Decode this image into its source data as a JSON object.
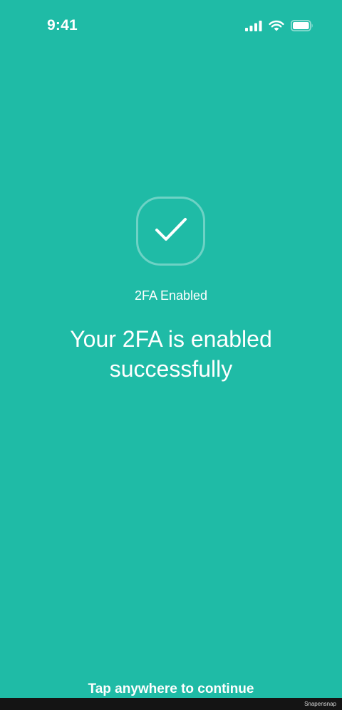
{
  "status_bar": {
    "time": "9:41",
    "icons": [
      "cellular-signal-icon",
      "wifi-icon",
      "battery-icon"
    ]
  },
  "success": {
    "icon": "checkmark-icon",
    "label": "2FA Enabled",
    "headline": "Your 2FA is enabled successfully"
  },
  "footer": {
    "tap_hint": "Tap anywhere to continue",
    "watermark": "Snapensnap"
  },
  "colors": {
    "background": "#1fbba6",
    "text": "#ffffff",
    "bottom_bar": "#141414"
  }
}
